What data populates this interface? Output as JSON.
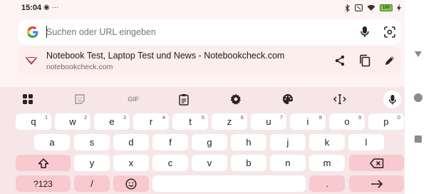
{
  "status_bar": {
    "time": "15:04",
    "left_glyphs": "◉ ···",
    "battery_label": "100"
  },
  "search": {
    "placeholder": "Suchen oder URL eingeben"
  },
  "suggestion": {
    "title": "Notebook Test, Laptop Test und News - Notebookcheck.com",
    "url": "notebookcheck.com"
  },
  "keyboard": {
    "toolbar": {
      "gif_label": "GIF"
    },
    "row1": [
      {
        "label": "q",
        "hint": "1"
      },
      {
        "label": "w",
        "hint": "2"
      },
      {
        "label": "e",
        "hint": "3"
      },
      {
        "label": "r",
        "hint": "4"
      },
      {
        "label": "t",
        "hint": "5"
      },
      {
        "label": "z",
        "hint": "6"
      },
      {
        "label": "u",
        "hint": "7"
      },
      {
        "label": "i",
        "hint": "8"
      },
      {
        "label": "o",
        "hint": "9"
      },
      {
        "label": "p",
        "hint": "0"
      }
    ],
    "row2": [
      "a",
      "s",
      "d",
      "f",
      "g",
      "h",
      "j",
      "k",
      "l"
    ],
    "row3": [
      "y",
      "x",
      "c",
      "v",
      "b",
      "n",
      "m"
    ],
    "row4": {
      "symbols": "?123",
      "slash": "/",
      "period": "."
    }
  },
  "colors": {
    "background": "#fdf3f2",
    "key": "#ffffff",
    "function_key": "#f8c9cf",
    "keyboard_bg": "#f6e6e7"
  }
}
